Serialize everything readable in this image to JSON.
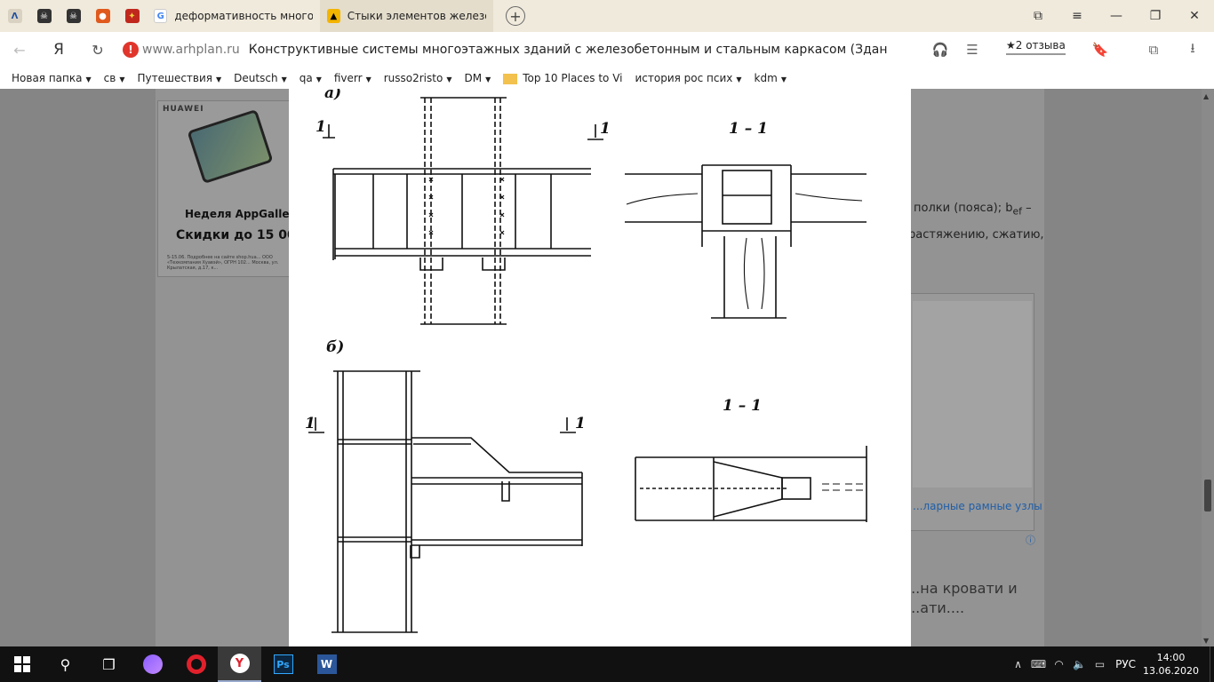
{
  "tabs": {
    "pinned": [
      "Λ",
      "",
      "",
      "",
      ""
    ],
    "items": [
      {
        "title": "деформативность многоэ"
      },
      {
        "title": "Стыки элементов железоб"
      }
    ],
    "new_tab": "+"
  },
  "window_controls": {
    "minimize": "—",
    "restore": "❐",
    "close": "✕",
    "menu": "≡",
    "bookmark_tab": "⧉"
  },
  "address": {
    "back": "←",
    "logo": "Я",
    "reload": "↻",
    "warning": "!",
    "host": "www.arhplan.ru",
    "title": "Конструктивные системы многоэтажных зданий с железобетонным и стальным каркасом (Здан...",
    "reviews": "★2 отзыва"
  },
  "bookmarks": [
    {
      "label": "Новая папка",
      "caret": true
    },
    {
      "label": "св",
      "caret": true
    },
    {
      "label": "Путешествия",
      "caret": true
    },
    {
      "label": "Deutsch",
      "caret": true
    },
    {
      "label": "qa",
      "caret": true
    },
    {
      "label": "fiverr",
      "caret": true
    },
    {
      "label": "russo2risto",
      "caret": true
    },
    {
      "label": "DM",
      "caret": true
    },
    {
      "label": "Top 10 Places to Vi",
      "caret": false,
      "icon": true
    },
    {
      "label": "история рос псих",
      "caret": true
    },
    {
      "label": "kdm",
      "caret": true
    }
  ],
  "ad": {
    "brand": "HUAWEI",
    "line1": "Неделя AppGalle",
    "line2": "Скидки до 15 00",
    "fine": "5-15.06. Подробнее на сайте shop.hua... ООО «Техкомпания Хуавэй», ОГРН 102... Москва, ул. Крылатская, д.17, к..."
  },
  "article": {
    "text1": "полки (пояса); b",
    "text1_sub": "ef",
    "text1_end": " –",
    "text2": "растяжению, сжатию,",
    "card_link": "...ларные рамные узлы",
    "bottom_line1": "...на кровати и",
    "bottom_line2": "...ати...."
  },
  "drawing": {
    "label_a": "а)",
    "label_b": "б)",
    "section_top": "1 – 1",
    "section_bottom": "1 – 1",
    "cut_mark": "1"
  },
  "taskbar": {
    "search": "⚲",
    "taskview": "❐",
    "photoshop": "Ps",
    "word": "W",
    "lang": "РУС",
    "time": "14:00",
    "date": "13.06.2020"
  }
}
